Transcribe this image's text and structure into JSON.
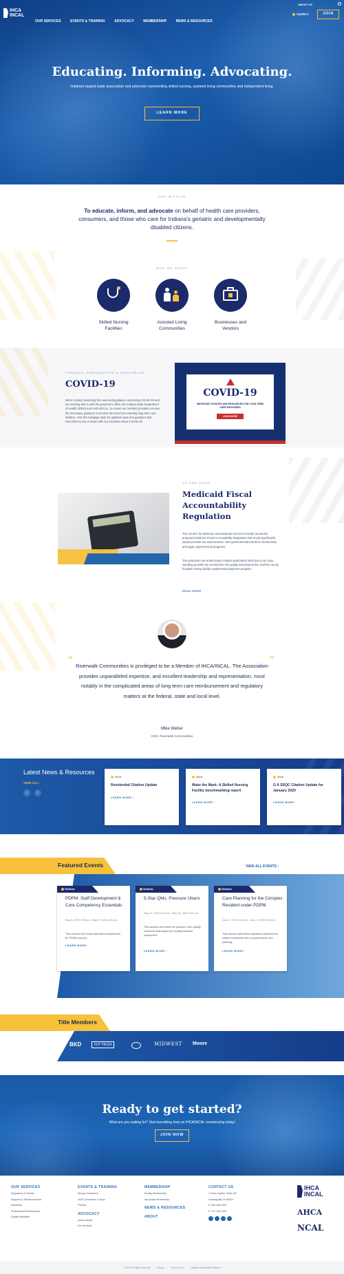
{
  "header": {
    "top_link": "ABOUT US",
    "logo_line1": "IHCA",
    "logo_line2": "INCAL",
    "nav": [
      "OUR SERVICES",
      "EVENTS & TRAINING",
      "ADVOCACY",
      "MEMBERSHIP",
      "NEWS & RESOURCES"
    ],
    "myihca": "myIHCA",
    "join": "JOIN"
  },
  "hero": {
    "title": "Educating. Informing. Advocating.",
    "subtitle": "Indiana's largest trade association and advocate representing skilled nursing, assisted living communities and independent living.",
    "cta": "LEARN MORE"
  },
  "mission": {
    "label": "OUR MISSION",
    "bold": "To educate, inform, and advocate",
    "text": " on behalf of health care providers, consumers, and those who care for Indiana's geriatric and developmentally disabled citizens."
  },
  "serve": {
    "label": "WHO WE SERVE",
    "items": [
      {
        "label": "Skilled Nursing Facilities",
        "icon": "stethoscope-icon"
      },
      {
        "label": "Assisted Living Communities",
        "icon": "family-icon"
      },
      {
        "label": "Businesses and Vendors",
        "icon": "briefcase-icon"
      }
    ]
  },
  "covid": {
    "label": "UPDATES, PREPARATION & RESOURCES",
    "title": "COVID-19",
    "body": "We're closely monitoring the news and guidance concerning COVID-19 and are working with in with the governor's office, the Indiana State Department of Health (ISDH) and AHCA/NCAL, to ensure our member providers receive the necessary guidance to prevent the virus from entering long term care facilities. Visit this webpage daily for updated news and guidance that IHCA/INCAL has to share with our members about COVID-19.",
    "link": "LEARN MORE",
    "banner_title": "COVID-19",
    "banner_sub": "IMPORTANT UPDATES AND RESOURCES FOR LONG-TERM CARE PROVIDERS",
    "banner_btn": "LEARN MORE"
  },
  "news_feature": {
    "label": "IN THE NEWS",
    "title": "Medicaid Fiscal Accountability Regulation",
    "p1": "The Centers for Medicare and Medicaid Services recently issued the proposed Medicaid Fiscal Accountability Regulation that would significantly impact provider tax assessments, inter-governmental transfers mechanisms and upper payment limit programs.",
    "p2": "The proposed rule would impact Indiana particularly hard due to our long-standing provider tax mechanism, the quality assessment fee, and the county hospital nursing facility supplemental payment program.",
    "link": "READ MORE"
  },
  "testimonial": {
    "quote": "Riverwalk Communities is privileged to be a Member of IHCA/INCAL. The Association provides unparalleled expertise, and excellent leadership and representation, most notably in the complicated areas of long term care reimbursement and regulatory matters at the federal, state and local level.",
    "name": "Mike Weber",
    "role": "CEO, Riverwalk Communities"
  },
  "latest": {
    "title": "Latest News & Resources",
    "view_all": "VIEW ALL",
    "cards": [
      {
        "tag": "Article",
        "title": "Residential Citation Update",
        "link": "LEARN MORE"
      },
      {
        "tag": "Article",
        "title": "Make the Mark: A Skilled Nursing Facility benchmarking report",
        "link": "LEARN MORE"
      },
      {
        "tag": "Article",
        "title": "G-9 SSQC Citation Update for January 2020",
        "link": "LEARN MORE"
      }
    ]
  },
  "events": {
    "title": "Featured Events",
    "view_all": "VIEW ALL EVENTS",
    "cards": [
      {
        "tag": "Webinar",
        "title": "PDPM: Staff Development & Core Competency Essentials",
        "date": "May 5, 2020 2:30 pm - May 5, 2020 3:45 pm",
        "body": "This session will review essential competencies for PDPM success.",
        "link": "LEARN MORE"
      },
      {
        "tag": "Webinar",
        "title": "5-Star QMs: Pressure Ulcers",
        "date": "May 20, 2020 2:30 pm - May 20, 2020 3:45 pm",
        "body": "This session will review the pressure ulcer quality measures that impact the Quality Measure component.",
        "link": "LEARN MORE"
      },
      {
        "tag": "Webinar",
        "title": "Care Planning for the Complex Resident under PDPM",
        "date": "June 2, 2020 2:30 pm - June 2, 2020 3:45 pm",
        "body": "This session will review regulatory requirements related to baseline and comprehensive care planning.",
        "link": "LEARN MORE"
      }
    ]
  },
  "members": {
    "title": "Title Members",
    "logos": [
      "BKD",
      "IVY TECH",
      "",
      "MIDWEST",
      "Moore"
    ]
  },
  "cta": {
    "title": "Ready to get started?",
    "sub": "What are you waiting for? Start benefiting from an IHCA/INCAL membership today!",
    "btn": "JOIN NOW"
  },
  "footer": {
    "services": {
      "h": "OUR SERVICES",
      "items": [
        "Regulatory & Clinical",
        "Payment & Reimbursement",
        "Workforce",
        "Professional Development",
        "Quality Initiatives"
      ]
    },
    "events": {
      "h": "EVENTS & TRAINING",
      "items": [
        "Spring Conference",
        "2020 Convention & Expo",
        "Policies"
      ]
    },
    "advocacy": {
      "h": "ADVOCACY",
      "items": [
        "Action Issues",
        "Get Involved"
      ]
    },
    "membership": {
      "h": "MEMBERSHIP",
      "items": [
        "Facility Membership",
        "Associate Membership"
      ]
    },
    "news": "NEWS & RESOURCES",
    "about": "ABOUT",
    "contact": {
      "h": "CONTACT US",
      "items": [
        "1 North Capitol, Suite 100",
        "Indianapolis, IN 46204",
        "P: 800.466.4422",
        "F: 317.236.7399"
      ]
    },
    "logo_ahca": "AHCA",
    "logo_ncal": "NCAL",
    "copyright": "© 2020 All Rights Reserved",
    "links": [
      "Privacy",
      "Terms of Use",
      "Website by Reusable Software"
    ]
  },
  "colors": {
    "navy": "#1b2a6b",
    "blue": "#2466a8",
    "yellow": "#f7c13c"
  }
}
